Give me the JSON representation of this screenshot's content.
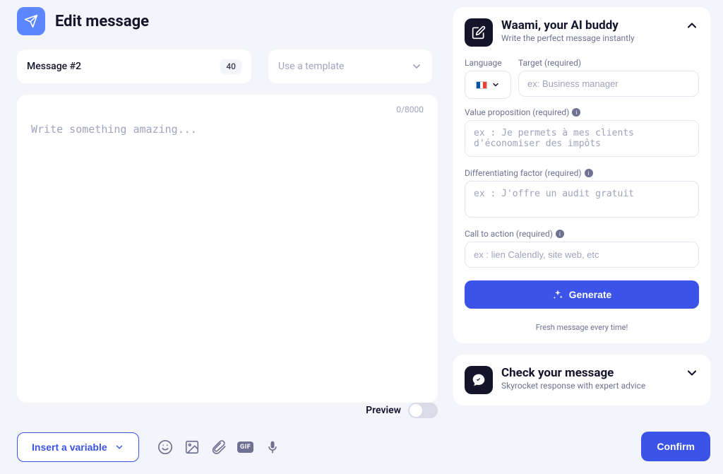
{
  "header": {
    "title": "Edit message"
  },
  "message_chip": {
    "label": "Message #2",
    "badge": "40"
  },
  "template": {
    "placeholder": "Use a template"
  },
  "editor": {
    "placeholder": "Write something amazing...",
    "counter": "0/8000",
    "value": ""
  },
  "preview": {
    "label": "Preview",
    "on": false
  },
  "toolbar": {
    "insert_variable": "Insert a variable",
    "icons": [
      "emoji-icon",
      "image-icon",
      "attachment-icon",
      "gif-icon",
      "mic-icon"
    ],
    "gif_label": "GIF"
  },
  "ai_panel": {
    "title": "Waami, your AI buddy",
    "subtitle": "Write the perfect message instantly",
    "language_label": "Language",
    "target_label": "Target (required)",
    "target_placeholder": "ex: Business manager",
    "value_label": "Value proposition (required)",
    "value_placeholder": "ex : Je permets à mes clients d'économiser des impôts",
    "diff_label": "Differentiating factor (required)",
    "diff_placeholder": "ex : J'offre un audit gratuit",
    "cta_label": "Call to action (required)",
    "cta_placeholder": "ex : lien Calendly, site web, etc",
    "generate": "Generate",
    "fresh": "Fresh message every time!"
  },
  "check_panel": {
    "title": "Check your message",
    "subtitle": "Skyrocket response with expert advice"
  },
  "confirm": "Confirm"
}
